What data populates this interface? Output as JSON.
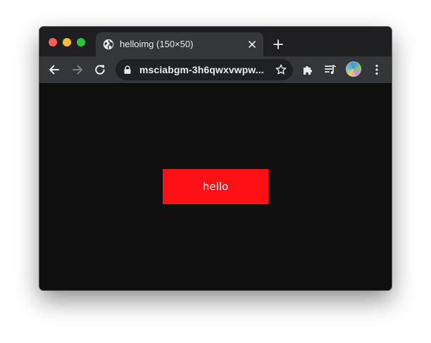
{
  "browser": {
    "tab": {
      "title": "helloimg (150×50)",
      "favicon": "globe-icon"
    },
    "address_bar": {
      "url": "msciabgm-3h6qwxvwpw..."
    },
    "icons": {
      "back": "back-arrow-icon",
      "forward": "forward-arrow-icon",
      "reload": "reload-icon",
      "lock": "lock-icon",
      "bookmark": "star-icon",
      "extensions": "puzzle-icon",
      "media": "media-queue-icon",
      "profile": "avatar",
      "menu": "kebab-menu-icon",
      "new_tab": "plus-icon",
      "close_tab": "close-icon"
    }
  },
  "page": {
    "image_text": "hello",
    "image_color": "#ff1014",
    "background_color": "#0f0f0f"
  }
}
